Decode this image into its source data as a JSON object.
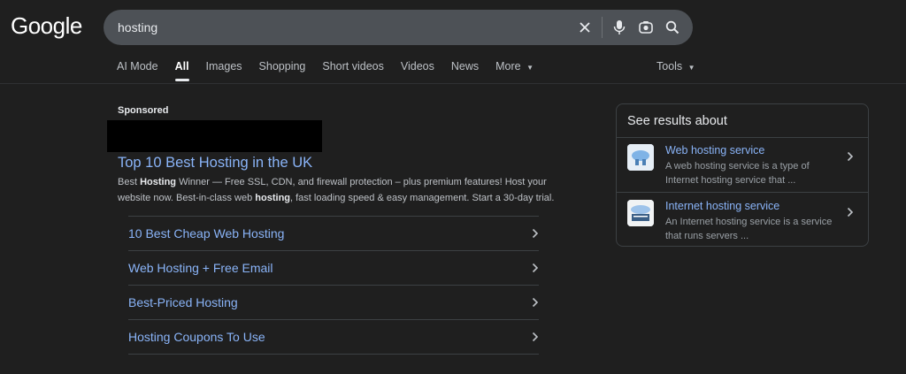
{
  "logo": "Google",
  "search": {
    "query": "hosting"
  },
  "tabs": [
    {
      "label": "AI Mode"
    },
    {
      "label": "All"
    },
    {
      "label": "Images"
    },
    {
      "label": "Shopping"
    },
    {
      "label": "Short videos"
    },
    {
      "label": "Videos"
    },
    {
      "label": "News"
    },
    {
      "label": "More"
    }
  ],
  "active_tab": "All",
  "tools_label": "Tools",
  "ad": {
    "sponsored_label": "Sponsored",
    "title": "Top 10 Best Hosting in the UK",
    "desc_parts": [
      "Best ",
      "Hosting",
      " Winner — Free SSL, CDN, and firewall protection – plus premium features! Host your website now. Best-in-class web ",
      "hosting",
      ", fast loading speed & easy management. Start a 30-day trial."
    ],
    "sitelinks": [
      {
        "label": "10 Best Cheap Web Hosting"
      },
      {
        "label": "Web Hosting + Free Email"
      },
      {
        "label": "Best-Priced Hosting"
      },
      {
        "label": "Hosting Coupons To Use"
      }
    ]
  },
  "panel": {
    "title": "See results about",
    "items": [
      {
        "title": "Web hosting service",
        "desc": "A web hosting service is a type of Internet hosting service that ..."
      },
      {
        "title": "Internet hosting service",
        "desc": "An Internet hosting service is a service that runs servers ..."
      }
    ]
  },
  "colors": {
    "background": "#1f1f1f",
    "link": "#8ab4f8",
    "searchbar": "#4d5156"
  }
}
